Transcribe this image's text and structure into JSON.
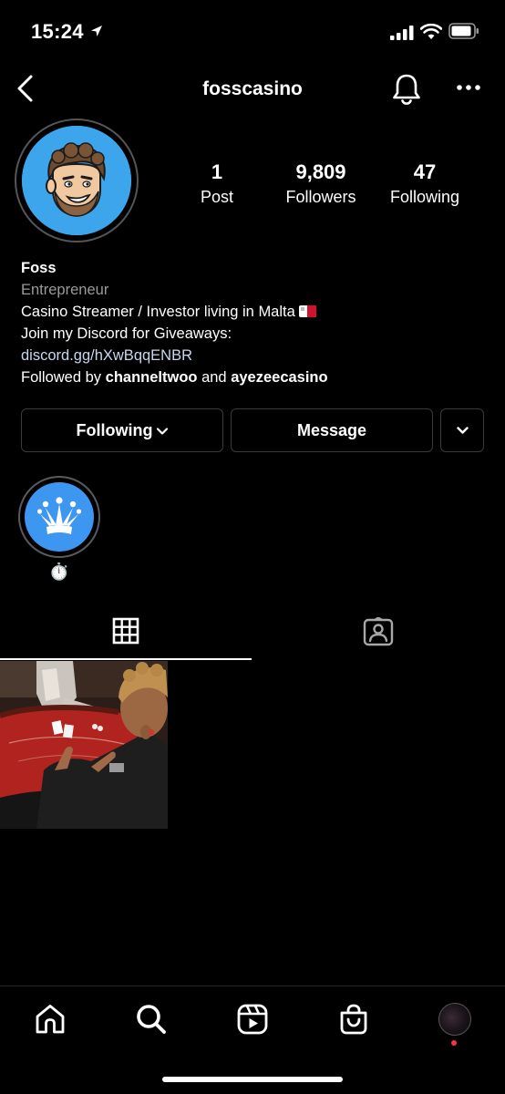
{
  "status_bar": {
    "time": "15:24"
  },
  "header": {
    "username": "fosscasino"
  },
  "profile": {
    "stats": {
      "posts": {
        "count": "1",
        "label": "Post"
      },
      "followers": {
        "count": "9,809",
        "label": "Followers"
      },
      "following": {
        "count": "47",
        "label": "Following"
      }
    },
    "name": "Foss",
    "category": "Entrepreneur",
    "bio_line1": "Casino Streamer / Investor living in Malta",
    "bio_line2": "Join my Discord for Giveaways:",
    "link": "discord.gg/hXwBqqENBR",
    "followed_by": {
      "prefix": "Followed by ",
      "user1": "channeltwoo",
      "conjunction": " and ",
      "user2": "ayezeecasino"
    }
  },
  "actions": {
    "following_label": "Following",
    "message_label": "Message"
  },
  "highlights": [
    {
      "label": "⏱️",
      "icon": "crown-icon"
    }
  ],
  "tabs": [
    {
      "name": "posts-grid",
      "icon": "grid-icon",
      "active": true
    },
    {
      "name": "tagged",
      "icon": "tagged-icon",
      "active": false
    }
  ],
  "colors": {
    "background": "#000000",
    "avatar_bg": "#3da5ec",
    "highlight_bg": "#3d96f0",
    "link": "#c8d7f0",
    "secondary_text": "#9a9a9a",
    "notification_dot": "#ff3040"
  }
}
